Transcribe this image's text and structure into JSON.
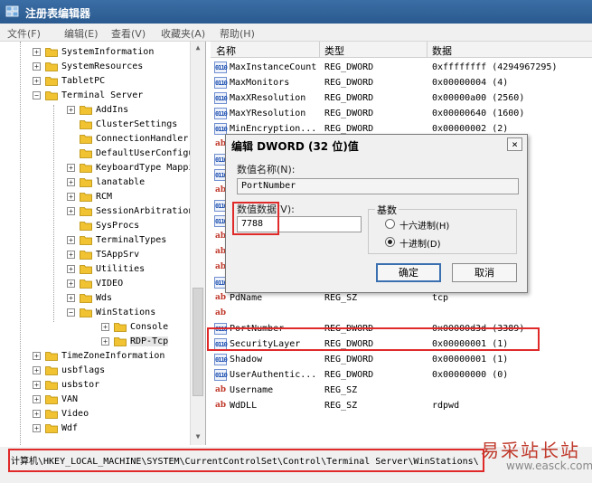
{
  "window": {
    "title": "注册表编辑器",
    "icon": "registry-editor-icon"
  },
  "menu": [
    "文件(F)",
    "编辑(E)",
    "查看(V)",
    "收藏夹(A)",
    "帮助(H)"
  ],
  "tree": [
    {
      "label": "SystemInformation",
      "expander": "+"
    },
    {
      "label": "SystemResources",
      "expander": "+"
    },
    {
      "label": "TabletPC",
      "expander": "+"
    },
    {
      "label": "Terminal Server",
      "expander": "−"
    },
    {
      "label": "AddIns",
      "expander": "+"
    },
    {
      "label": "ClusterSettings",
      "expander": ""
    },
    {
      "label": "ConnectionHandler",
      "expander": ""
    },
    {
      "label": "DefaultUserConfigura",
      "expander": ""
    },
    {
      "label": "KeyboardType Mapping",
      "expander": "+"
    },
    {
      "label": "lanatable",
      "expander": "+"
    },
    {
      "label": "RCM",
      "expander": "+"
    },
    {
      "label": "SessionArbitrationHe",
      "expander": "+"
    },
    {
      "label": "SysProcs",
      "expander": ""
    },
    {
      "label": "TerminalTypes",
      "expander": "+"
    },
    {
      "label": "TSAppSrv",
      "expander": "+"
    },
    {
      "label": "Utilities",
      "expander": "+"
    },
    {
      "label": "VIDEO",
      "expander": "+"
    },
    {
      "label": "Wds",
      "expander": "+"
    },
    {
      "label": "WinStations",
      "expander": "−"
    },
    {
      "label": "Console",
      "expander": "+"
    },
    {
      "label": "RDP-Tcp",
      "expander": "+"
    },
    {
      "label": "TimeZoneInformation",
      "expander": "+"
    },
    {
      "label": "usbflags",
      "expander": "+"
    },
    {
      "label": "usbstor",
      "expander": "+"
    },
    {
      "label": "VAN",
      "expander": "+"
    },
    {
      "label": "Video",
      "expander": "+"
    },
    {
      "label": "Wdf",
      "expander": "+"
    }
  ],
  "list": {
    "columns": [
      "名称",
      "类型",
      "数据"
    ],
    "rows": [
      {
        "name": "MaxInstanceCount",
        "type": "REG_DWORD",
        "data": "0xffffffff (4294967295)",
        "kind": "dword"
      },
      {
        "name": "MaxMonitors",
        "type": "REG_DWORD",
        "data": "0x00000004 (4)",
        "kind": "dword"
      },
      {
        "name": "MaxXResolution",
        "type": "REG_DWORD",
        "data": "0x00000a00 (2560)",
        "kind": "dword"
      },
      {
        "name": "MaxYResolution",
        "type": "REG_DWORD",
        "data": "0x00000640 (1600)",
        "kind": "dword"
      },
      {
        "name": "MinEncryption...",
        "type": "REG_DWORD",
        "data": "0x00000002 (2)",
        "kind": "dword"
      },
      {
        "name": "",
        "type": "",
        "data": "",
        "kind": "sz"
      },
      {
        "name": "",
        "type": "",
        "data": "",
        "kind": "dword"
      },
      {
        "name": "",
        "type": "",
        "data": "",
        "kind": "dword"
      },
      {
        "name": "",
        "type": "",
        "data": "",
        "kind": "sz"
      },
      {
        "name": "",
        "type": "",
        "data": "",
        "kind": "dword"
      },
      {
        "name": "",
        "type": "",
        "data": "",
        "kind": "dword"
      },
      {
        "name": "",
        "type": "",
        "data": "",
        "kind": "sz"
      },
      {
        "name": "",
        "type": "",
        "data": "",
        "kind": "sz"
      },
      {
        "name": "",
        "type": "",
        "data": "",
        "kind": "sz"
      },
      {
        "name": "",
        "type": "",
        "data": "",
        "kind": "dword"
      },
      {
        "name": "PdName",
        "type": "REG_SZ",
        "data": "tcp",
        "kind": "sz"
      },
      {
        "name": "",
        "type": "",
        "data": "",
        "kind": "sz"
      },
      {
        "name": "PortNumber",
        "type": "REG_DWORD",
        "data": "0x00000d3d (3389)",
        "kind": "dword"
      },
      {
        "name": "SecurityLayer",
        "type": "REG_DWORD",
        "data": "0x00000001 (1)",
        "kind": "dword"
      },
      {
        "name": "Shadow",
        "type": "REG_DWORD",
        "data": "0x00000001 (1)",
        "kind": "dword"
      },
      {
        "name": "UserAuthentic...",
        "type": "REG_DWORD",
        "data": "0x00000000 (0)",
        "kind": "dword"
      },
      {
        "name": "Username",
        "type": "REG_SZ",
        "data": "",
        "kind": "sz"
      },
      {
        "name": "WdDLL",
        "type": "REG_SZ",
        "data": "rdpwd",
        "kind": "sz"
      }
    ]
  },
  "dialog": {
    "title": "编辑 DWORD (32 位)值",
    "close": "×",
    "name_label": "数值名称(N):",
    "name_value": "PortNumber",
    "data_label": "数值数据(V):",
    "data_value": "7788",
    "base_label": "基数",
    "radio_hex": "十六进制(H)",
    "radio_dec": "十进制(D)",
    "ok": "确定",
    "cancel": "取消"
  },
  "status": {
    "path": "计算机\\HKEY_LOCAL_MACHINE\\SYSTEM\\CurrentControlSet\\Control\\Terminal Server\\WinStations\\"
  },
  "watermark": {
    "text": "易采站长站",
    "url": "www.easck.com"
  }
}
